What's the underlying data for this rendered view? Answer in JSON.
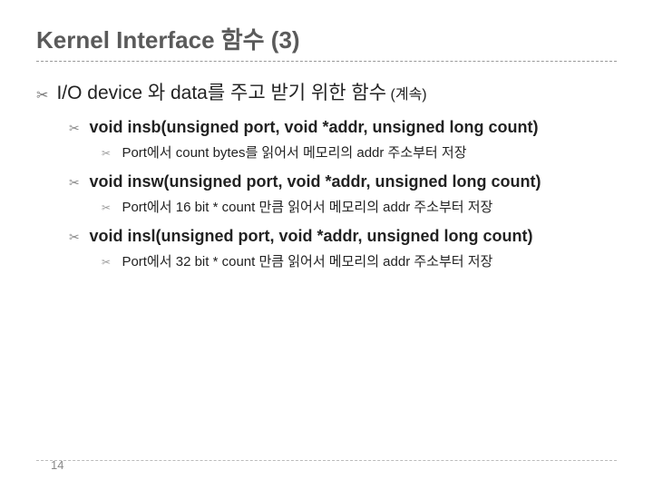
{
  "title": "Kernel Interface 함수 (3)",
  "section": {
    "heading": "I/O device 와 data를 주고 받기 위한 함수",
    "heading_suffix": "(계속)",
    "items": [
      {
        "signature": "void insb(unsigned port, void *addr, unsigned long count)",
        "description": "Port에서 count bytes를 읽어서 메모리의 addr 주소부터 저장"
      },
      {
        "signature": "void insw(unsigned port, void *addr, unsigned long count)",
        "description": "Port에서 16 bit * count 만큼 읽어서 메모리의 addr 주소부터 저장"
      },
      {
        "signature": "void insl(unsigned port, void *addr, unsigned long count)",
        "description": "Port에서 32 bit * count 만큼 읽어서 메모리의 addr 주소부터 저장"
      }
    ]
  },
  "page_number": "14",
  "bullets": {
    "l1": "✂",
    "l2": "✂",
    "l3": "✂"
  }
}
